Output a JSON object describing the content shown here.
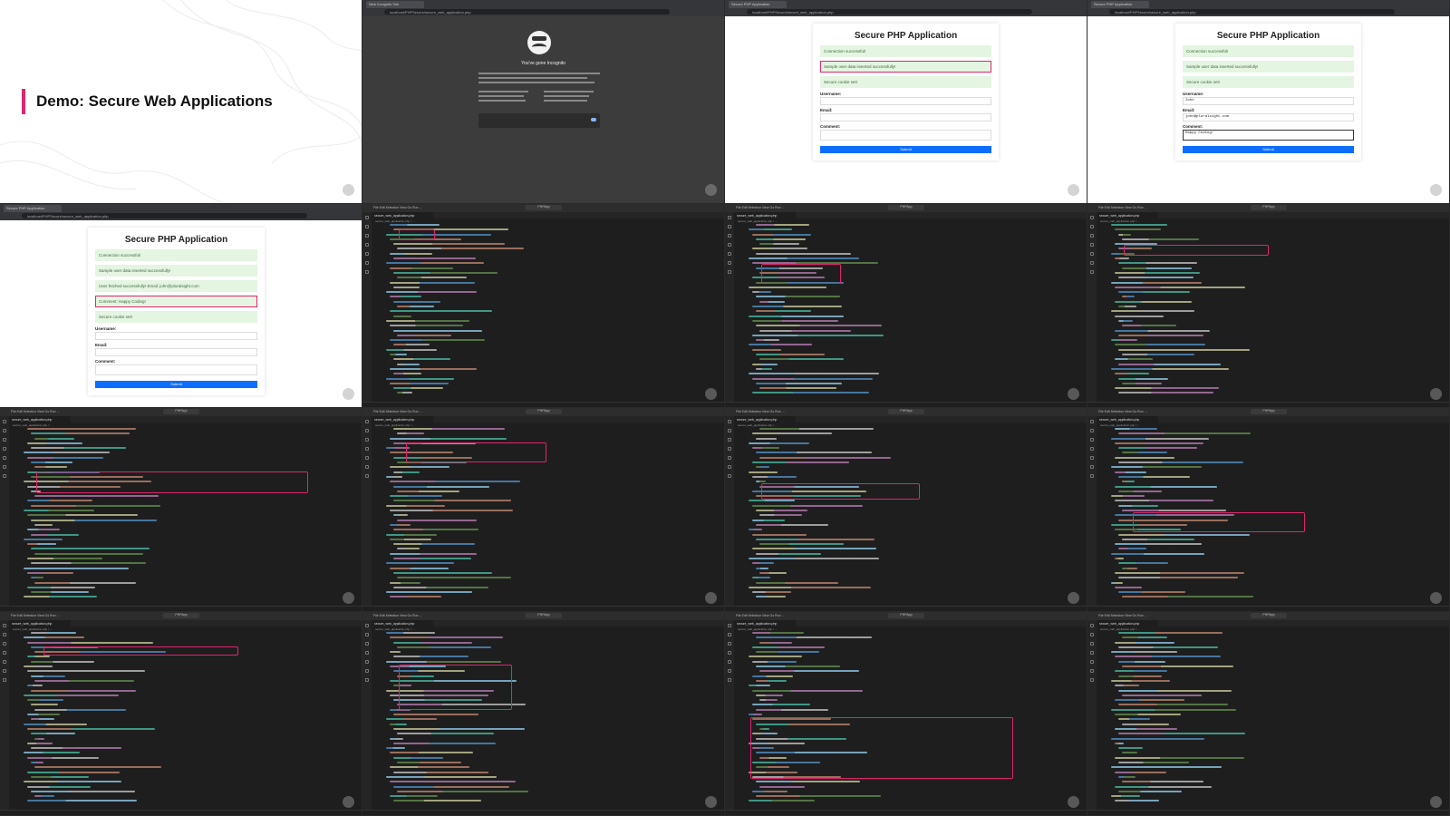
{
  "slide": {
    "title": "Demo: Secure Web Applications"
  },
  "browser": {
    "tab_title": "Secure PHP Application",
    "url": "localhost/PHPSecure/secure_web_application.php",
    "incognito_tab": "New Incognito Tab",
    "incognito_heading": "You've gone Incognito"
  },
  "app": {
    "title": "Secure PHP Application",
    "msg_connection": "Connection successful!",
    "msg_inserted": "Sample user data inserted successfully!",
    "msg_fetched": "User fetched successfully! Email: john@pluralsight.com",
    "msg_comment": "Comment: Happy Coding!",
    "msg_cookie": "Secure cookie set!",
    "label_username": "Username:",
    "label_email": "Email:",
    "label_comment": "Comment:",
    "submit": "Submit",
    "filled_username": "John",
    "filled_email": "john@pluralsight.com",
    "filled_comment": "Happy Coding!"
  },
  "editor": {
    "menu": "File  Edit  Selection  View  Go  Run  …",
    "search": "PHPApp",
    "file_tab": "secure_web_application.php",
    "breadcrumb": "secure_web_application.php > ..."
  },
  "colors": {
    "accent": "#e0256d",
    "submit": "#0d6efd",
    "success_bg": "#e4f5e1"
  }
}
